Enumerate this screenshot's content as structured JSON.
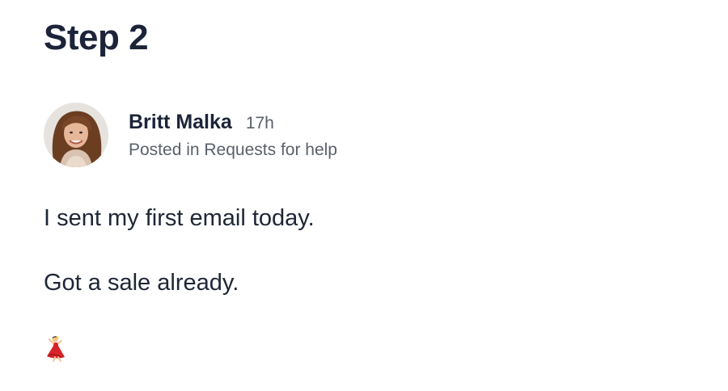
{
  "page": {
    "title": "Step 2"
  },
  "post": {
    "author_name": "Britt Malka",
    "time_ago": "17h",
    "posted_in": "Posted in Requests for help",
    "body_lines": [
      "I sent my first email today.",
      "Got a sale already."
    ],
    "reaction_icon": "dancer-emoji-icon"
  }
}
